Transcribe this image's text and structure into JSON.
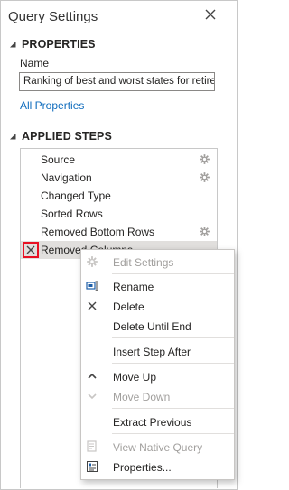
{
  "pane": {
    "title": "Query Settings"
  },
  "properties": {
    "heading": "PROPERTIES",
    "name_label": "Name",
    "name_value": "Ranking of best and worst states for retire",
    "all_properties_link": "All Properties"
  },
  "applied_steps": {
    "heading": "APPLIED STEPS",
    "items": [
      {
        "label": "Source",
        "has_gear": true
      },
      {
        "label": "Navigation",
        "has_gear": true
      },
      {
        "label": "Changed Type",
        "has_gear": false
      },
      {
        "label": "Sorted Rows",
        "has_gear": false
      },
      {
        "label": "Removed Bottom Rows",
        "has_gear": true
      },
      {
        "label": "Removed Columns",
        "has_gear": false,
        "selected": true
      }
    ]
  },
  "context_menu": {
    "items": [
      {
        "label": "Edit Settings",
        "icon": "gear-icon",
        "disabled": true
      },
      {
        "label": "Rename",
        "icon": "rename-icon",
        "disabled": false
      },
      {
        "label": "Delete",
        "icon": "delete-icon",
        "disabled": false
      },
      {
        "label": "Delete Until End",
        "icon": "",
        "disabled": false
      },
      {
        "label": "Insert Step After",
        "icon": "",
        "disabled": false
      },
      {
        "label": "Move Up",
        "icon": "chevron-up-icon",
        "disabled": false
      },
      {
        "label": "Move Down",
        "icon": "chevron-down-icon",
        "disabled": true
      },
      {
        "label": "Extract Previous",
        "icon": "",
        "disabled": false
      },
      {
        "label": "View Native Query",
        "icon": "native-query-icon",
        "disabled": true
      },
      {
        "label": "Properties...",
        "icon": "properties-icon",
        "disabled": false
      }
    ]
  },
  "colors": {
    "accent_link": "#0f6cbd",
    "selected_row": "#e1dfdd",
    "delete_highlight": "#e81123",
    "disabled_text": "#a19f9d"
  }
}
